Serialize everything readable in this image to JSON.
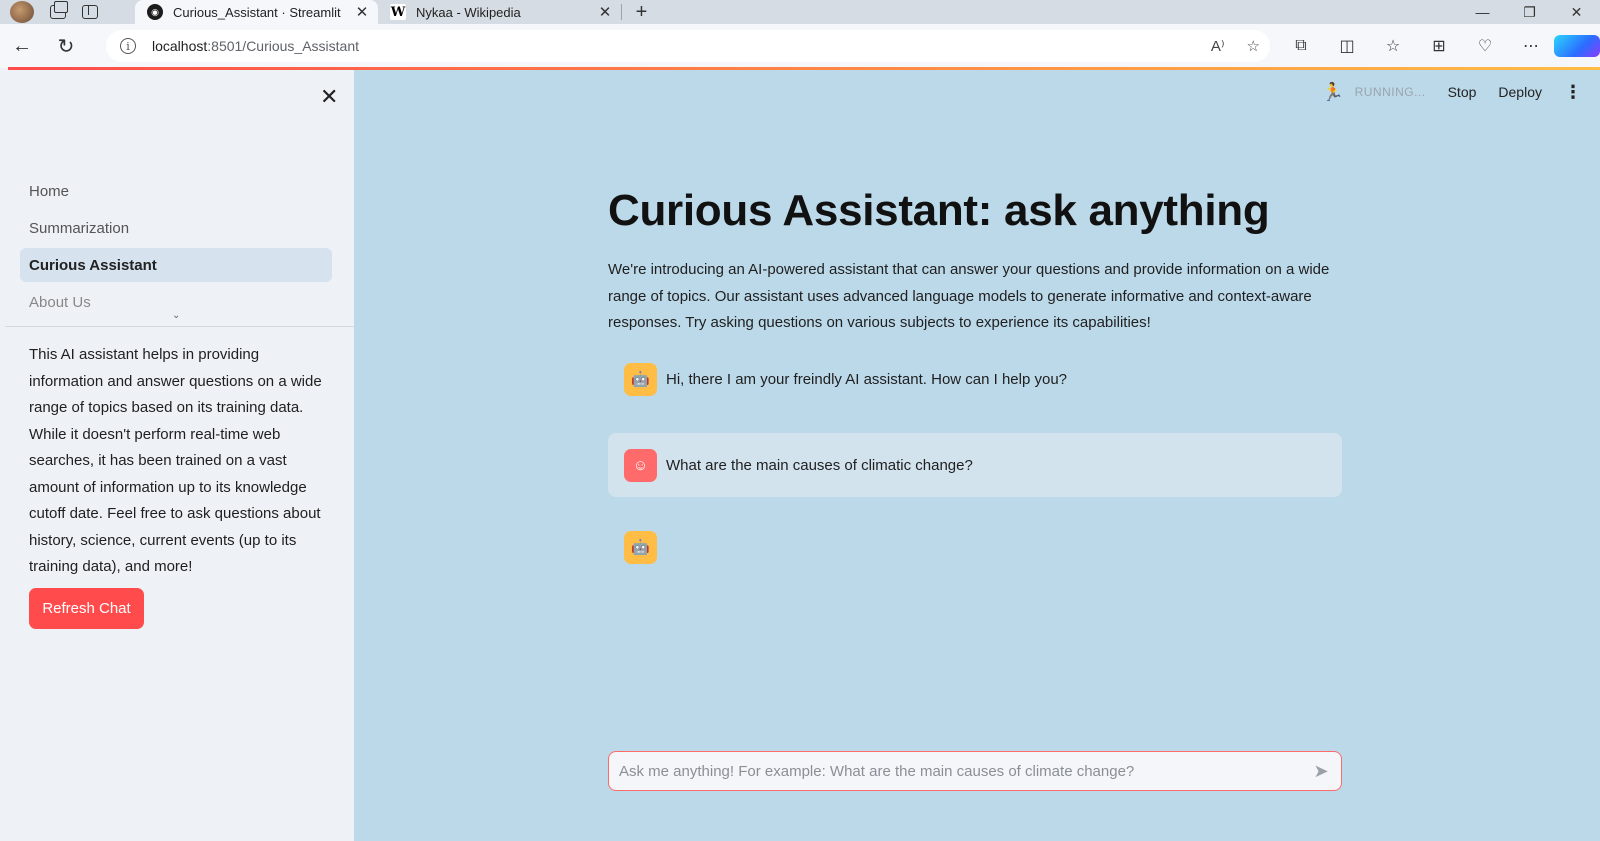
{
  "browser": {
    "tabs": [
      {
        "title": "Curious_Assistant · Streamlit",
        "active": true,
        "favicon": "streamlit-icon"
      },
      {
        "title": "Nykaa - Wikipedia",
        "active": false,
        "favicon": "wikipedia-icon"
      }
    ],
    "url_host": "localhost",
    "url_rest": ":8501/Curious_Assistant",
    "window_controls": {
      "minimize": "—",
      "restore": "❐",
      "close": "✕"
    }
  },
  "sidebar": {
    "close_glyph": "✕",
    "nav": [
      {
        "label": "Home",
        "active": false
      },
      {
        "label": "Summarization",
        "active": false
      },
      {
        "label": "Curious Assistant",
        "active": true
      },
      {
        "label": "About Us",
        "active": false
      }
    ],
    "info_text": "This AI assistant helps in providing information and answer questions on a wide range of topics based on its training data. While it doesn't perform real-time web searches, it has been trained on a vast amount of information up to its knowledge cutoff date. Feel free to ask questions about history, science, current events (up to its training data), and more!",
    "refresh_label": "Refresh Chat"
  },
  "header": {
    "status": "RUNNING...",
    "stop_label": "Stop",
    "deploy_label": "Deploy"
  },
  "main": {
    "title": "Curious Assistant: ask anything",
    "intro": "We're introducing an AI-powered assistant that can answer your questions and provide information on a wide range of topics. Our assistant uses advanced language models to generate informative and context-aware responses. Try asking questions on various subjects to experience its capabilities!",
    "messages": [
      {
        "role": "assistant",
        "text": "Hi, there I am your freindly AI assistant. How can I help you?"
      },
      {
        "role": "user",
        "text": "What are the main causes of climatic change?"
      },
      {
        "role": "assistant",
        "text": ""
      }
    ],
    "input_placeholder": "Ask me anything! For example: What are the main causes of climate change?"
  },
  "colors": {
    "accent": "#ff4b4b",
    "main_bg": "#bcd9ea",
    "sidebar_bg": "#eef1f6",
    "bot_avatar": "#ffbd45",
    "user_avatar": "#ff6b6b"
  }
}
